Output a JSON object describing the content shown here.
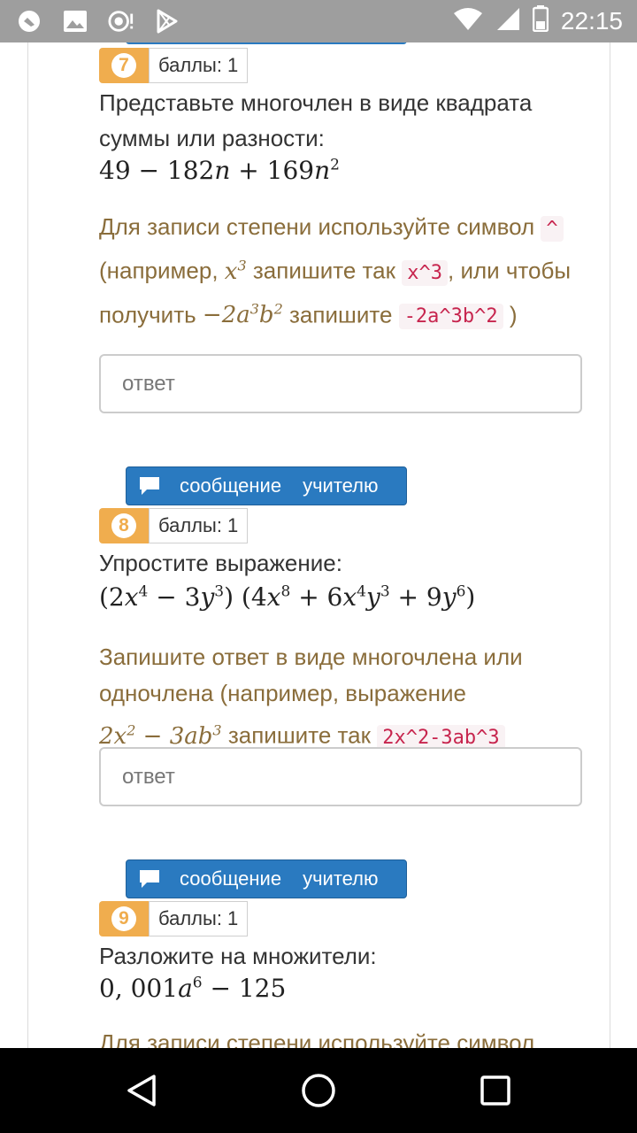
{
  "status_bar": {
    "time": "22:15",
    "icons_left": [
      "vpn-icon",
      "gallery-icon",
      "camera-icon",
      "play-store-icon"
    ],
    "icons_right": [
      "wifi-icon",
      "signal-icon",
      "battery-icon"
    ]
  },
  "questions": [
    {
      "number": "7",
      "points": "баллы: 1",
      "prompt": "Представьте многочлен в виде квадрата суммы или разности:",
      "hint": {
        "t1": "Для записи степени используйте символ",
        "code1": "^",
        "t2": "(например,",
        "t3": "запишите так",
        "code2": "x^3",
        "t4": ", или чтобы получить",
        "t5": "запишите",
        "code3": "-2a^3b^2",
        "t6": ")"
      },
      "answer_placeholder": "ответ"
    },
    {
      "number": "8",
      "points": "баллы: 1",
      "message_button": [
        "сообщение",
        "учителю"
      ],
      "prompt": "Упростите выражение:",
      "hint": {
        "t1": "Запишите ответ в виде многочлена или одночлена (например, выражение",
        "t2": "запишите так",
        "code1": "2x^2-3ab^3"
      },
      "answer_placeholder": "ответ"
    },
    {
      "number": "9",
      "points": "баллы: 1",
      "message_button": [
        "сообщение",
        "учителю"
      ],
      "prompt": "Разложите на множители:",
      "hint_partial": "Для записи степени используйте символ"
    }
  ]
}
